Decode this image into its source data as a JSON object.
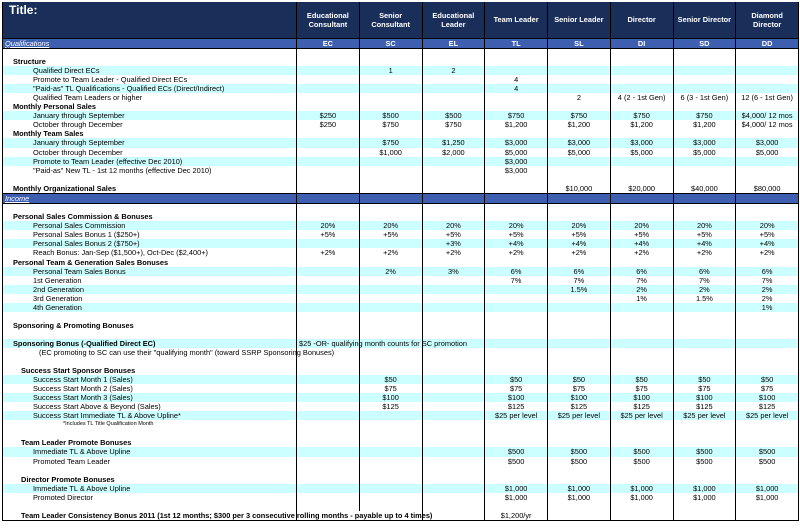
{
  "header": {
    "title": "Title:",
    "columns": [
      "Educational Consultant",
      "Senior Consultant",
      "Educational Leader",
      "Team Leader",
      "Senior Leader",
      "Director",
      "Senior Director",
      "Diamond Director"
    ]
  },
  "qualifications": {
    "label": "Qualifications",
    "codes": [
      "EC",
      "SC",
      "EL",
      "TL",
      "SL",
      "DI",
      "SD",
      "DD"
    ]
  },
  "rows": [
    {
      "type": "blank",
      "cy": false
    },
    {
      "type": "head",
      "label": "Structure",
      "cy": false,
      "v": [
        "",
        "",
        "",
        "",
        "",
        "",
        "",
        ""
      ]
    },
    {
      "type": "row",
      "indent": "i1",
      "label": "Qualified Direct ECs",
      "cy": true,
      "v": [
        "",
        "1",
        "2",
        "",
        "",
        "",
        "",
        ""
      ],
      "align": "n"
    },
    {
      "type": "row",
      "indent": "i1",
      "label": "Promote to Team Leader - Qualified Direct ECs",
      "cy": false,
      "v": [
        "",
        "",
        "",
        "4",
        "",
        "",
        "",
        ""
      ],
      "align": "n"
    },
    {
      "type": "row",
      "indent": "i1",
      "label": "\"Paid-as\" TL Qualifications - Qualified ECs (Direct/Indirect)",
      "cy": true,
      "v": [
        "",
        "",
        "",
        "4",
        "",
        "",
        "",
        ""
      ],
      "align": "n"
    },
    {
      "type": "row",
      "indent": "i1",
      "label": "Qualified Team Leaders or higher",
      "cy": false,
      "v": [
        "",
        "",
        "",
        "",
        "2",
        "4 (2 - 1st Gen)",
        "6 (3 - 1st Gen)",
        "12 (6 - 1st Gen)"
      ],
      "align": "n"
    },
    {
      "type": "head",
      "label": "Monthly Personal Sales",
      "cy": false,
      "v": [
        "",
        "",
        "",
        "",
        "",
        "",
        "",
        ""
      ]
    },
    {
      "type": "row",
      "indent": "i1",
      "label": "January through September",
      "cy": true,
      "v": [
        "$250",
        "$500",
        "$500",
        "$750",
        "$750",
        "$750",
        "$750",
        "$4,000/ 12 mos"
      ],
      "align": "n"
    },
    {
      "type": "row",
      "indent": "i1",
      "label": "October through December",
      "cy": false,
      "v": [
        "$250",
        "$750",
        "$750",
        "$1,200",
        "$1,200",
        "$1,200",
        "$1,200",
        "$4,000/ 12 mos"
      ],
      "align": "n"
    },
    {
      "type": "head",
      "label": "Monthly Team Sales",
      "cy": false,
      "v": [
        "",
        "",
        "",
        "",
        "",
        "",
        "",
        ""
      ]
    },
    {
      "type": "row",
      "indent": "i1",
      "label": "January through September",
      "cy": true,
      "v": [
        "",
        "$750",
        "$1,250",
        "$3,000",
        "$3,000",
        "$3,000",
        "$3,000",
        "$3,000"
      ],
      "align": "n"
    },
    {
      "type": "row",
      "indent": "i1",
      "label": "October through December",
      "cy": false,
      "v": [
        "",
        "$1,000",
        "$2,000",
        "$5,000",
        "$5,000",
        "$5,000",
        "$5,000",
        "$5,000"
      ],
      "align": "n"
    },
    {
      "type": "row",
      "indent": "i1",
      "label": "Promote to Team Leader (effective Dec 2010)",
      "cy": true,
      "v": [
        "",
        "",
        "",
        "$3,000",
        "",
        "",
        "",
        ""
      ],
      "align": "n"
    },
    {
      "type": "row",
      "indent": "i1",
      "label": "\"Paid-as\" New TL - 1st 12 months (effective Dec 2010)",
      "cy": false,
      "v": [
        "",
        "",
        "",
        "$3,000",
        "",
        "",
        "",
        ""
      ],
      "align": "n"
    },
    {
      "type": "blank",
      "cy": false
    },
    {
      "type": "head",
      "label": "Monthly Organizational Sales",
      "cy": false,
      "v": [
        "",
        "",
        "",
        "",
        "$10,000",
        "$20,000",
        "$40,000",
        "$80,000"
      ],
      "align": "n"
    }
  ],
  "income": {
    "label": "Income"
  },
  "income_rows": [
    {
      "type": "blank",
      "cy": false
    },
    {
      "type": "head",
      "label": "Personal Sales Commission & Bonuses",
      "cy": false,
      "v": [
        "",
        "",
        "",
        "",
        "",
        "",
        "",
        ""
      ]
    },
    {
      "type": "row",
      "indent": "i1",
      "label": "Personal Sales Commission",
      "cy": true,
      "v": [
        "20%",
        "20%",
        "20%",
        "20%",
        "20%",
        "20%",
        "20%",
        "20%"
      ],
      "align": "n"
    },
    {
      "type": "row",
      "indent": "i1",
      "label": "Personal Sales Bonus 1 ($250+)",
      "cy": false,
      "v": [
        "+5%",
        "+5%",
        "+5%",
        "+5%",
        "+5%",
        "+5%",
        "+5%",
        "+5%"
      ],
      "align": "n"
    },
    {
      "type": "row",
      "indent": "i1",
      "label": "Personal Sales Bonus 2 ($750+)",
      "cy": true,
      "v": [
        "",
        "",
        "+3%",
        "+4%",
        "+4%",
        "+4%",
        "+4%",
        "+4%"
      ],
      "align": "n"
    },
    {
      "type": "row",
      "indent": "i1",
      "label": "Reach Bonus: Jan-Sep ($1,500+), Oct-Dec ($2,400+)",
      "cy": false,
      "v": [
        "+2%",
        "+2%",
        "+2%",
        "+2%",
        "+2%",
        "+2%",
        "+2%",
        "+2%"
      ],
      "align": "n"
    },
    {
      "type": "head",
      "label": "Personal Team & Generation Sales Bonuses",
      "cy": false,
      "v": [
        "",
        "",
        "",
        "",
        "",
        "",
        "",
        ""
      ]
    },
    {
      "type": "row",
      "indent": "i1",
      "label": "Personal Team Sales Bonus",
      "cy": true,
      "v": [
        "",
        "2%",
        "3%",
        "6%",
        "6%",
        "6%",
        "6%",
        "6%"
      ],
      "align": "n"
    },
    {
      "type": "row",
      "indent": "i1",
      "label": "1st Generation",
      "cy": false,
      "v": [
        "",
        "",
        "",
        "7%",
        "7%",
        "7%",
        "7%",
        "7%"
      ],
      "align": "n"
    },
    {
      "type": "row",
      "indent": "i1",
      "label": "2nd Generation",
      "cy": true,
      "v": [
        "",
        "",
        "",
        "",
        "1.5%",
        "2%",
        "2%",
        "2%"
      ],
      "align": "n"
    },
    {
      "type": "row",
      "indent": "i1",
      "label": "3rd Generation",
      "cy": false,
      "v": [
        "",
        "",
        "",
        "",
        "",
        "1%",
        "1.5%",
        "2%"
      ],
      "align": "n"
    },
    {
      "type": "row",
      "indent": "i1",
      "label": "4th Generation",
      "cy": true,
      "v": [
        "",
        "",
        "",
        "",
        "",
        "",
        "",
        "1%"
      ],
      "align": "n"
    },
    {
      "type": "blank",
      "cy": false
    },
    {
      "type": "head",
      "label": "Sponsoring & Promoting Bonuses",
      "cy": false,
      "v": [
        "",
        "",
        "",
        "",
        "",
        "",
        "",
        ""
      ]
    },
    {
      "type": "blank",
      "cy": false
    },
    {
      "type": "spanhead",
      "label": "Sponsoring Bonus (-Qualified Direct EC)",
      "span": "$25 -OR- qualifying month counts for SC promotion",
      "cy": true
    },
    {
      "type": "note",
      "label": "(EC promoting to SC can use their \"qualifying month\" (toward SSRP Sponsoring Bonuses)",
      "cy": false
    },
    {
      "type": "blank",
      "cy": false
    },
    {
      "type": "head",
      "indent": "i2",
      "label": "Success Start Sponsor Bonuses",
      "cy": false,
      "v": [
        "",
        "",
        "",
        "",
        "",
        "",
        "",
        ""
      ]
    },
    {
      "type": "row",
      "indent": "i1",
      "label": "Success Start Month 1 (Sales)",
      "cy": true,
      "v": [
        "",
        "$50",
        "",
        "$50",
        "$50",
        "$50",
        "$50",
        "$50"
      ],
      "align": "n"
    },
    {
      "type": "row",
      "indent": "i1",
      "label": "Success Start Month 2 (Sales)",
      "cy": false,
      "v": [
        "",
        "$75",
        "",
        "$75",
        "$75",
        "$75",
        "$75",
        "$75"
      ],
      "align": "n"
    },
    {
      "type": "row",
      "indent": "i1",
      "label": "Success Start Month 3 (Sales)",
      "cy": true,
      "v": [
        "",
        "$100",
        "",
        "$100",
        "$100",
        "$100",
        "$100",
        "$100"
      ],
      "align": "n"
    },
    {
      "type": "row",
      "indent": "i1",
      "label": "Success Start Above & Beyond (Sales)",
      "cy": false,
      "v": [
        "",
        "$125",
        "",
        "$125",
        "$125",
        "$125",
        "$125",
        "$125"
      ],
      "align": "n"
    },
    {
      "type": "row",
      "indent": "i1",
      "label": "Success Start Immediate TL & Above Upline*",
      "cy": true,
      "v": [
        "",
        "",
        "",
        "$25 per level",
        "$25 per level",
        "$25 per level",
        "$25 per level",
        "$25 per level"
      ],
      "align": "n"
    },
    {
      "type": "smallnote",
      "label": "*Includes TL Title Qualification Month",
      "cy": false
    },
    {
      "type": "blank",
      "cy": false
    },
    {
      "type": "head",
      "indent": "i2",
      "label": "Team Leader Promote Bonuses",
      "cy": false,
      "v": [
        "",
        "",
        "",
        "",
        "",
        "",
        "",
        ""
      ]
    },
    {
      "type": "row",
      "indent": "i1",
      "label": "Immediate TL & Above Upline",
      "cy": true,
      "v": [
        "",
        "",
        "",
        "$500",
        "$500",
        "$500",
        "$500",
        "$500"
      ],
      "align": "n"
    },
    {
      "type": "row",
      "indent": "i1",
      "label": "Promoted Team Leader",
      "cy": false,
      "v": [
        "",
        "",
        "",
        "$500",
        "$500",
        "$500",
        "$500",
        "$500"
      ],
      "align": "n"
    },
    {
      "type": "blank",
      "cy": false
    },
    {
      "type": "head",
      "indent": "i2",
      "label": "Director Promote Bonuses",
      "cy": false,
      "v": [
        "",
        "",
        "",
        "",
        "",
        "",
        "",
        ""
      ]
    },
    {
      "type": "row",
      "indent": "i1",
      "label": "Immediate TL & Above Upline",
      "cy": true,
      "v": [
        "",
        "",
        "",
        "$1,000",
        "$1,000",
        "$1,000",
        "$1,000",
        "$1,000"
      ],
      "align": "n"
    },
    {
      "type": "row",
      "indent": "i1",
      "label": "Promoted Director",
      "cy": false,
      "v": [
        "",
        "",
        "",
        "$1,000",
        "$1,000",
        "$1,000",
        "$1,000",
        "$1,000"
      ],
      "align": "n"
    },
    {
      "type": "blank",
      "cy": false
    },
    {
      "type": "bottom",
      "indent": "i2",
      "label": "Team Leader Consistency Bonus 2011 (1st 12 months; $300 per 3 consecutive rolling months - payable up to 4 times)",
      "v": [
        "",
        "",
        "",
        "$1,200/yr",
        "",
        "",
        "",
        ""
      ],
      "cy": false
    }
  ]
}
